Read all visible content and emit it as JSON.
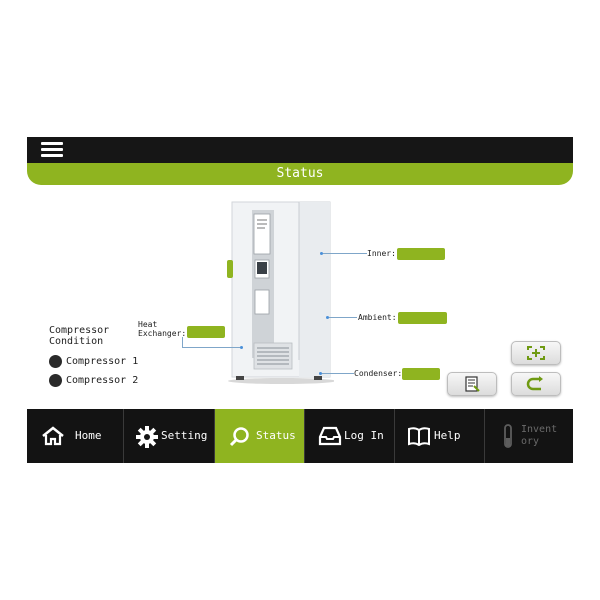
{
  "header": {
    "title": "Status",
    "menu_icon": "hamburger-menu-icon"
  },
  "sensors": {
    "inner": {
      "label": "Inner:",
      "value": ""
    },
    "ambient": {
      "label": "Ambient:",
      "value": ""
    },
    "condenser": {
      "label": "Condenser:",
      "value": ""
    },
    "heat_exchanger": {
      "label_line1": "Heat",
      "label_line2": "Exchanger:",
      "value": ""
    }
  },
  "compressor": {
    "title_line1": "Compressor",
    "title_line2": "Condition",
    "items": [
      {
        "label": "Compressor 1",
        "status_color": "#2a2a2a"
      },
      {
        "label": "Compressor 2",
        "status_color": "#2a2a2a"
      }
    ]
  },
  "side_buttons": [
    {
      "name": "fullscreen",
      "icon": "expand-frame-icon"
    },
    {
      "name": "report",
      "icon": "report-document-icon"
    },
    {
      "name": "back",
      "icon": "return-arrow-icon"
    }
  ],
  "nav": [
    {
      "label": "Home",
      "icon": "home-icon"
    },
    {
      "label": "Setting",
      "icon": "gear-icon"
    },
    {
      "label": "Status",
      "icon": "search-icon",
      "active": true
    },
    {
      "label": "Log In",
      "icon": "inbox-tray-icon"
    },
    {
      "label": "Help",
      "icon": "book-icon"
    },
    {
      "label_line1": "Invent",
      "label_line2": "ory",
      "icon": "test-tube-icon",
      "disabled": true
    }
  ],
  "colors": {
    "accent": "#8fb420",
    "bar": "#161616",
    "nav_bg": "#131313"
  }
}
